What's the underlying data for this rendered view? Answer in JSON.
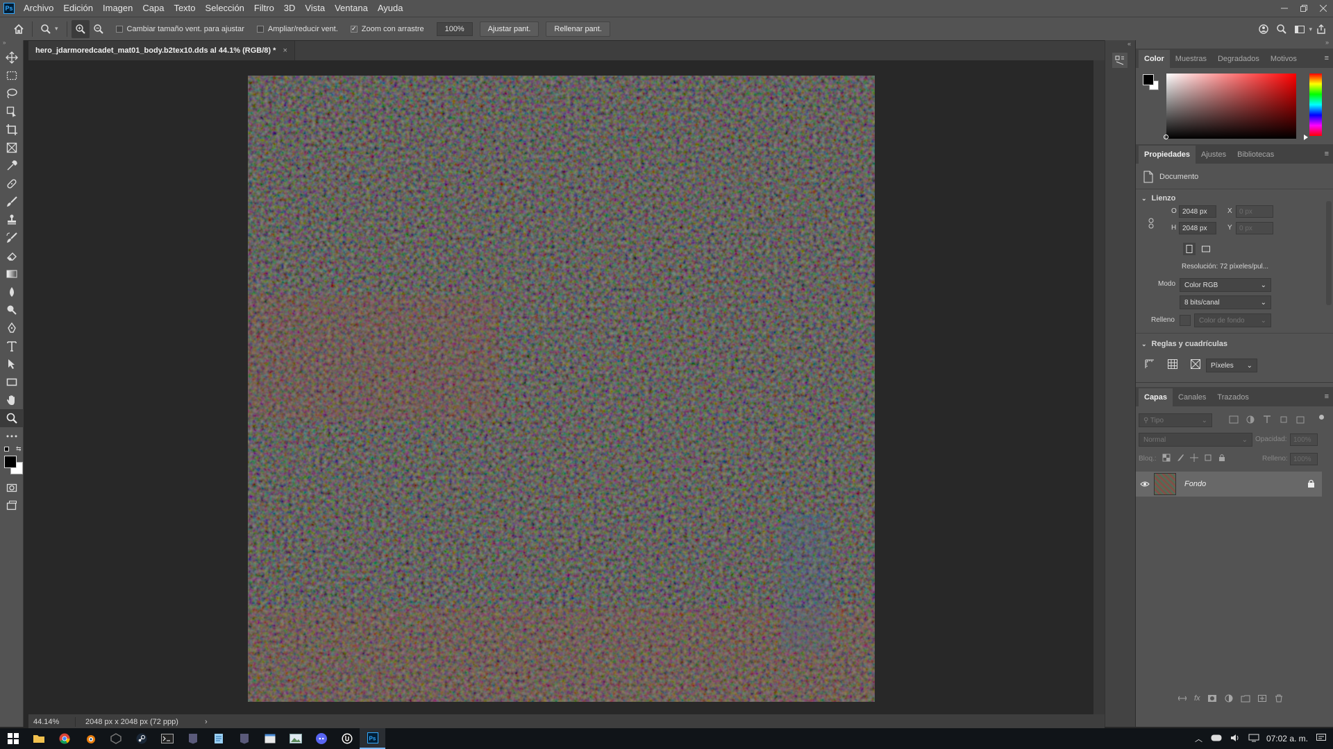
{
  "app": {
    "logo_text": "Ps"
  },
  "menu": [
    "Archivo",
    "Edición",
    "Imagen",
    "Capa",
    "Texto",
    "Selección",
    "Filtro",
    "3D",
    "Vista",
    "Ventana",
    "Ayuda"
  ],
  "options": {
    "resize_windows": {
      "label": "Cambiar tamaño vent. para ajustar",
      "checked": false
    },
    "zoom_all": {
      "label": "Ampliar/reducir vent.",
      "checked": false
    },
    "scrubby_zoom": {
      "label": "Zoom con arrastre",
      "checked": true
    },
    "zoom_value": "100%",
    "fit_screen": "Ajustar pant.",
    "fill_screen": "Rellenar pant."
  },
  "document": {
    "tab_title": "hero_jdarmoredcadet_mat01_body.b2tex10.dds al 44.1% (RGB/8) *",
    "close_glyph": "×",
    "status_zoom": "44.14%",
    "status_info": "2048 px x 2048 px (72 ppp)",
    "status_arrow": "›"
  },
  "color_panel": {
    "tabs": [
      "Color",
      "Muestras",
      "Degradados",
      "Motivos"
    ],
    "active_tab": "Color",
    "foreground": "#000000",
    "background": "#ffffff",
    "hue_color": "#ff0000"
  },
  "properties_panel": {
    "tabs": [
      "Propiedades",
      "Ajustes",
      "Bibliotecas"
    ],
    "active_tab": "Propiedades",
    "doc_label": "Documento",
    "canvas_section": "Lienzo",
    "width_label": "O",
    "width_value": "2048 px",
    "height_label": "H",
    "height_value": "2048 px",
    "x_label": "X",
    "x_placeholder": "0 px",
    "y_label": "Y",
    "y_placeholder": "0 px",
    "resolution": "Resolución:  72 píxeles/pul...",
    "mode_label": "Modo",
    "mode_value": "Color RGB",
    "depth_value": "8 bits/canal",
    "fill_label": "Relleno",
    "fill_value": "Color de fondo",
    "rulers_section": "Reglas y cuadrículas",
    "units_value": "Píxeles"
  },
  "layers_panel": {
    "tabs": [
      "Capas",
      "Canales",
      "Trazados"
    ],
    "active_tab": "Capas",
    "filter_placeholder": "Tipo",
    "blend_mode": "Normal",
    "opacity_label": "Opacidad:",
    "opacity_value": "100%",
    "lock_label": "Bloq.:",
    "fill_label": "Relleno:",
    "fill_value": "100%",
    "layers": [
      {
        "name": "Fondo",
        "visible": true,
        "locked": true
      }
    ]
  },
  "taskbar": {
    "time": "07:02 a. m.",
    "apps": [
      "windows-start",
      "file-explorer",
      "chrome",
      "blender",
      "unity",
      "steam",
      "terminal",
      "epic-games",
      "notepad",
      "epic-games-2",
      "window-manager",
      "gallery",
      "discord",
      "unreal",
      "photoshop"
    ],
    "active_app": "photoshop"
  }
}
